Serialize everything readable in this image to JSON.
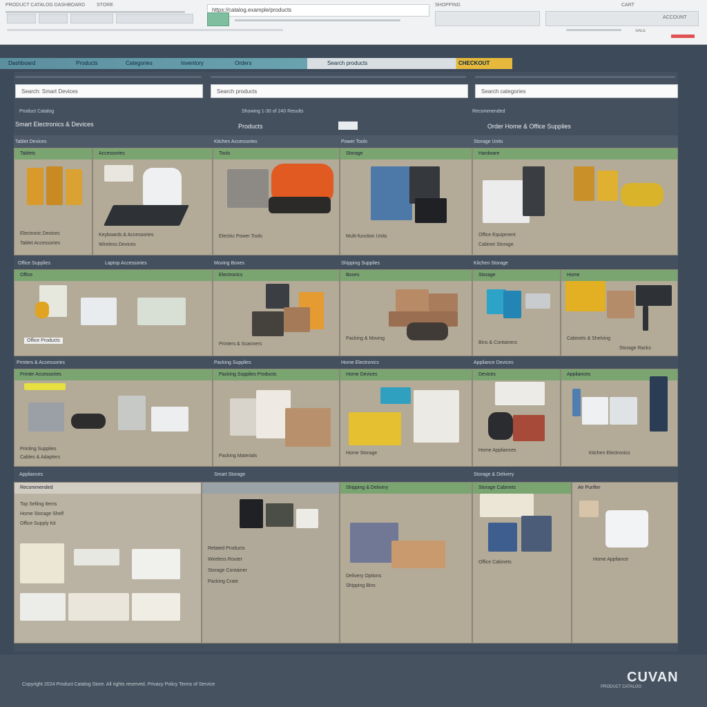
{
  "browser": {
    "tabs": [
      "PRODUCT CATALOG DASHBOARD",
      "STORE",
      "SHOPPING",
      "CART"
    ],
    "address": "https://catalog.example/products",
    "right_status": "ACCOUNT",
    "badge": "SALE"
  },
  "nav": {
    "tabs": [
      "Dashboard",
      "Products",
      "Categories",
      "Inventory",
      "Orders",
      "Search products",
      "CHECKOUT"
    ]
  },
  "search": {
    "fields": [
      "Search: Smart Devices",
      "Search products",
      "Search categories"
    ]
  },
  "sections": {
    "left_header": "Product Catalog",
    "left_title": "Smart Electronics & Devices",
    "mid_header": "Showing 1-30 of 240 Results",
    "mid_title": "Products",
    "right_header": "Recommended",
    "right_title": "Order Home & Office Supplies"
  },
  "grid": {
    "rows": [
      {
        "labels": [
          "Tablet Devices",
          "Kitchen Accessories",
          "Power Tools",
          "Storage Units"
        ],
        "cells": [
          {
            "head": "Tablets",
            "text": [
              "Electronic Devices",
              "Tablet Accessories"
            ]
          },
          {
            "head": "Accessories",
            "text": [
              "Keyboards & Accessories",
              "Wireless Devices"
            ]
          },
          {
            "head": "Tools",
            "text": [
              "Electric Power Tools"
            ]
          },
          {
            "head": "Storage",
            "text": [
              "Multi-function Units"
            ]
          },
          {
            "head": "Hardware",
            "text": [
              "Office Equipment",
              "Cabinet Storage"
            ]
          }
        ]
      },
      {
        "labels": [
          "Office Supplies",
          "Laptop Accessories",
          "Moving Boxes",
          "Shipping Supplies",
          "Kitchen Storage"
        ],
        "cells": [
          {
            "head": "Office",
            "text": [
              "Office Products"
            ]
          },
          {
            "head": "Electronics",
            "text": [
              "Printers & Scanners"
            ]
          },
          {
            "head": "Boxes",
            "text": [
              "Packing & Moving"
            ]
          },
          {
            "head": "Storage",
            "text": [
              "Bins & Containers"
            ]
          },
          {
            "head": "Home",
            "text": [
              "Cabinets & Shelving",
              "Storage Racks"
            ]
          }
        ]
      },
      {
        "labels": [
          "Printers & Accessories",
          "Packing Supplies",
          "Home Electronics",
          "Appliance Devices"
        ],
        "cells": [
          {
            "head": "Printer Accessories",
            "text": [
              "Printing Supplies",
              "Cables & Adapters"
            ]
          },
          {
            "head": "Packing Supplies Products",
            "text": [
              "Packing Materials"
            ]
          },
          {
            "head": "Home Devices",
            "text": [
              "Home Storage"
            ]
          },
          {
            "head": "Devices",
            "text": [
              "Home Appliances"
            ]
          },
          {
            "head": "Appliances",
            "text": [
              "Kitchen Electronics"
            ]
          }
        ]
      }
    ],
    "bottom_labels": [
      "Appliances",
      "Smart Storage",
      "Storage & Delivery"
    ],
    "bottom_cells": [
      {
        "head": "Recommended",
        "text": [
          "Top Selling Items",
          "Home Storage Shelf",
          "Office Supply Kit"
        ]
      },
      {
        "head": "",
        "text": [
          "Related Products",
          "Wireless Router",
          "Storage Container",
          "Packing Crate"
        ]
      },
      {
        "head": "Shipping & Delivery",
        "text": [
          "Delivery Options",
          "Shipping Bins"
        ]
      },
      {
        "head": "Storage Cabinets",
        "text": [
          "Office Cabinets"
        ]
      },
      {
        "head": "Air Purifier",
        "text": [
          "Home Appliance"
        ]
      }
    ]
  },
  "footer": {
    "text": "Copyright 2024 Product Catalog Store. All rights reserved. Privacy Policy Terms of Service",
    "brand": "CUVAN",
    "brand_sub": "PRODUCT CATALOG"
  },
  "colors": {
    "accent": "#7aa571",
    "bg": "#3d4a59",
    "card": "#b3aa98",
    "nav": "#5c8fa0",
    "badge": "#e6b93d"
  }
}
